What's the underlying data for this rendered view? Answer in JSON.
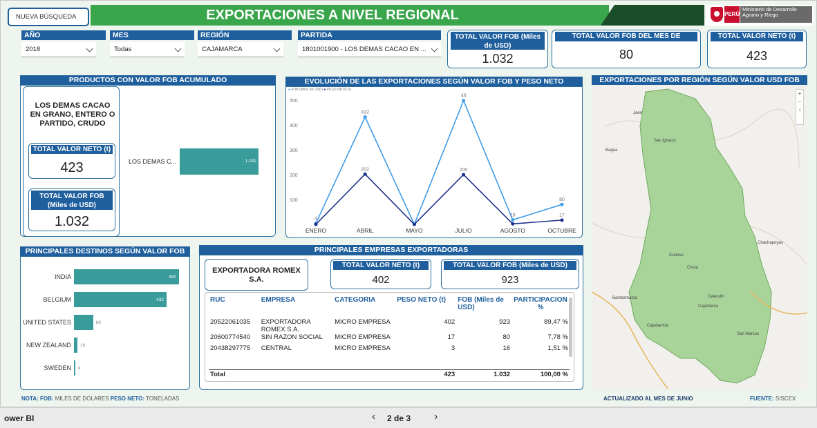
{
  "header": {
    "new_search": "NUEVA BÚSQUEDA",
    "title": "EXPORTACIONES A NIVEL REGIONAL",
    "peru": "PERÚ",
    "ministry": "Ministerio de Desarrollo Agrario y Riego"
  },
  "filters": {
    "year": {
      "label": "AÑO",
      "value": "2018"
    },
    "month": {
      "label": "MES",
      "value": "Todas"
    },
    "region": {
      "label": "REGIÓN",
      "value": "CAJAMARCA"
    },
    "partida": {
      "label": "PARTIDA",
      "value": "1801001900 - LOS DEMAS CACAO EN ..."
    }
  },
  "kpis": {
    "fob_total": {
      "label": "TOTAL VALOR FOB (Miles de USD)",
      "value": "1.032"
    },
    "fob_month": {
      "label": "TOTAL VALOR FOB DEL MES DE OCTUBRE",
      "value": "80"
    },
    "net_total": {
      "label": "TOTAL VALOR NETO (t)",
      "value": "423"
    }
  },
  "products": {
    "title": "PRODUCTOS CON VALOR FOB ACUMULADO",
    "product_name": "LOS DEMAS CACAO EN GRANO, ENTERO O PARTIDO, CRUDO",
    "net_label": "TOTAL VALOR NETO (t)",
    "net_value": "423",
    "fob_label": "TOTAL VALOR FOB (Miles de USD)",
    "fob_value": "1.032",
    "bar_label": "LOS DEMAS C...",
    "bar_value": "1.032"
  },
  "evolution": {
    "title": "EVOLUCIÓN DE LAS EXPORTACIONES SEGÚN VALOR FOB Y PESO NETO",
    "legend": [
      "FOB (Miles de USD)",
      "PESO NETO (t)"
    ]
  },
  "chart_data": {
    "type": "line",
    "x": [
      "ENERO",
      "ABRIL",
      "MAYO",
      "JULIO",
      "AGOSTO",
      "OCTUBRE"
    ],
    "ylim": [
      0,
      500
    ],
    "yticks": [
      100,
      200,
      300,
      400,
      500
    ],
    "series": [
      {
        "name": "FOB (Miles de USD)",
        "values": [
          4,
          432,
          0,
          498,
          18,
          80
        ],
        "labels": [
          "4",
          "432",
          "",
          "49",
          "18",
          "80"
        ],
        "color": "#3f9be8"
      },
      {
        "name": "PESO NETO (t)",
        "values": [
          0,
          202,
          0,
          200,
          2,
          17
        ],
        "labels": [
          "",
          "202",
          "",
          "200",
          "",
          "17"
        ],
        "color": "#1c2f8a"
      }
    ]
  },
  "destinations": {
    "title": "PRINCIPALES DESTINOS SEGÚN VALOR FOB",
    "items": [
      {
        "country": "INDIA",
        "value": 490
      },
      {
        "country": "BELGIUM",
        "value": 432
      },
      {
        "country": "UNITED STATES",
        "value": 89
      },
      {
        "country": "NEW ZEALAND",
        "value": 16
      },
      {
        "country": "SWEDEN",
        "value": 4
      }
    ]
  },
  "companies": {
    "title": "PRINCIPALES EMPRESAS EXPORTADORAS",
    "top_name": "EXPORTADORA ROMEX S.A.",
    "net_label": "TOTAL VALOR NETO (t)",
    "net_value": "402",
    "fob_label": "TOTAL VALOR FOB (Miles de USD)",
    "fob_value": "923",
    "columns": [
      "RUC",
      "EMPRESA",
      "CATEGORIA",
      "PESO NETO (t)",
      "FOB (Miles de USD)",
      "PARTICIPACION %"
    ],
    "rows": [
      {
        "ruc": "20522061035",
        "empresa": "EXPORTADORA ROMEX S.A.",
        "categoria": "MICRO EMPRESA",
        "peso": "402",
        "fob": "923",
        "part": "89,47 %"
      },
      {
        "ruc": "20600774540",
        "empresa": "SIN RAZON SOCIAL",
        "categoria": "MICRO EMPRESA",
        "peso": "17",
        "fob": "80",
        "part": "7,78 %"
      },
      {
        "ruc": "20438297775",
        "empresa": "CENTRAL",
        "categoria": "MICRO EMPRESA",
        "peso": "3",
        "fob": "16",
        "part": "1,51 %"
      }
    ],
    "total": {
      "label": "Total",
      "peso": "423",
      "fob": "1.032",
      "part": "100,00 %"
    }
  },
  "map": {
    "title": "EXPORTACIONES POR REGIÓN SEGÚN VALOR USD FOB",
    "places": [
      "Jaén",
      "San Ignacio",
      "Bagua",
      "Chachapoyas",
      "Cutervo",
      "Chota",
      "Cajamarca",
      "San Marcos",
      "Celendín",
      "Cajabamba",
      "Bambamarca"
    ]
  },
  "footer": {
    "note_fob_key": "NOTA: FOB:",
    "note_fob": "MILES DE DOLARES",
    "note_peso_key": "PESO NETO:",
    "note_peso": "TONELADAS",
    "updated": "ACTUALIZADO AL MES DE JUNIO",
    "source_key": "FUENTE:",
    "source": "SISCEX"
  },
  "statusbar": {
    "app": "ower BI",
    "page": "2 de 3"
  }
}
